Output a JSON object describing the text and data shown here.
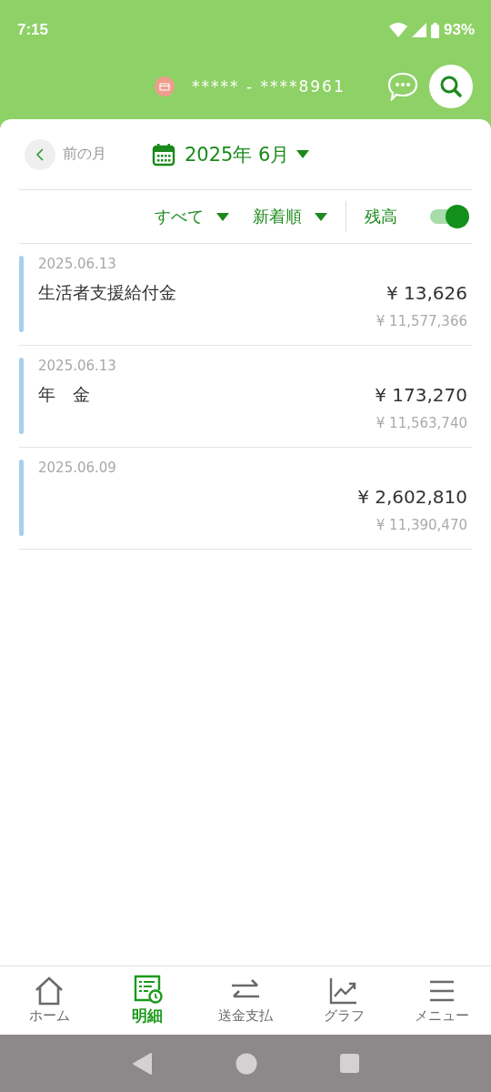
{
  "status_bar": {
    "time": "7:15",
    "battery": "93%"
  },
  "header": {
    "account": "***** - ****8961"
  },
  "month_nav": {
    "previous": "前の月",
    "month": "2025年 6月"
  },
  "filters": [
    {
      "label": "すべて"
    },
    {
      "label": "新着順"
    }
  ],
  "balance_toggle": {
    "label": "残高",
    "on": true
  },
  "transactions": [
    {
      "date": "2025.06.13",
      "description": "生活者支援給付金",
      "amount": "¥ 13,626",
      "balance": "¥ 11,577,366"
    },
    {
      "date": "2025.06.13",
      "description": "年　金",
      "amount": "¥ 173,270",
      "balance": "¥ 11,563,740"
    },
    {
      "date": "2025.06.09",
      "amount": "¥ 2,602,810",
      "balance": "¥ 11,390,470"
    }
  ],
  "bottom_nav": [
    {
      "kind": "home",
      "label": "ホーム",
      "selected": false
    },
    {
      "kind": "statement",
      "label": "明細",
      "selected": true
    },
    {
      "kind": "transfer",
      "label": "送金支払",
      "selected": false
    },
    {
      "kind": "graph",
      "label": "グラフ",
      "selected": false
    },
    {
      "kind": "menu",
      "label": "メニュー",
      "selected": false
    }
  ]
}
